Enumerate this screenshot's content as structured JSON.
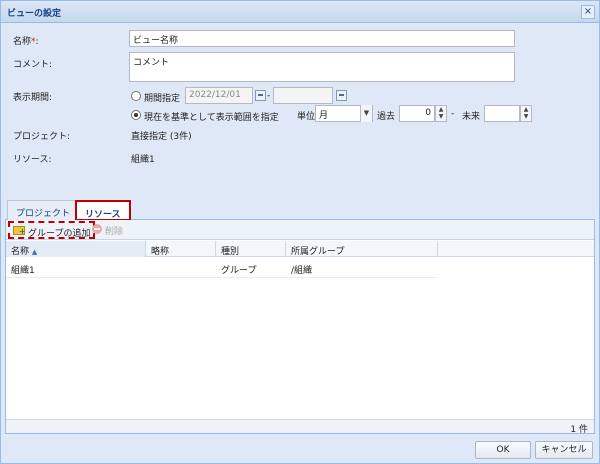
{
  "dialog": {
    "title": "ビューの設定",
    "close_symbol": "×"
  },
  "form": {
    "name_label": "名称",
    "required_mark": "*",
    "name_colon": ":",
    "name_value": "ビュー名称",
    "comment_label": "コメント:",
    "comment_value": "コメント",
    "period_label": "表示期間:",
    "period_option1": "期間指定",
    "period_start": "2022/12/01",
    "period_separator": "-",
    "period_end": "",
    "period_option2": "現在を基準として表示範囲を指定",
    "period_option2_selected": true,
    "unit_label": "単位",
    "unit_value": "月",
    "past_label": "過去",
    "past_value": "0",
    "range_separator": "-",
    "future_label": "未来",
    "future_value": "",
    "project_label": "プロジェクト:",
    "project_value": "直接指定 (3件)",
    "resource_label": "リソース:",
    "resource_value": "組織1"
  },
  "tabs": [
    {
      "label": "プロジェクト",
      "active": false
    },
    {
      "label": "リソース",
      "active": true
    }
  ],
  "toolbar": {
    "add_group": "グループの追加",
    "delete": "削除"
  },
  "grid": {
    "columns": [
      "名称",
      "略称",
      "種別",
      "所属グループ"
    ],
    "sort_indicator": "▲",
    "rows": [
      {
        "name": "組織1",
        "abbr": "",
        "type": "グループ",
        "group": "/組織"
      }
    ],
    "count": "1 件"
  },
  "buttons": {
    "ok": "OK",
    "cancel": "キャンセル"
  },
  "icons": {
    "close": "close-icon",
    "calendar": "calendar-icon",
    "folder_add": "folder-add-icon",
    "delete": "delete-icon",
    "dropdown": "chevron-down-icon",
    "spinner": "spinner-icon"
  },
  "colors": {
    "highlight": "#c00000",
    "title_text": "#15428b",
    "panel_bg": "#dfe8f6"
  }
}
